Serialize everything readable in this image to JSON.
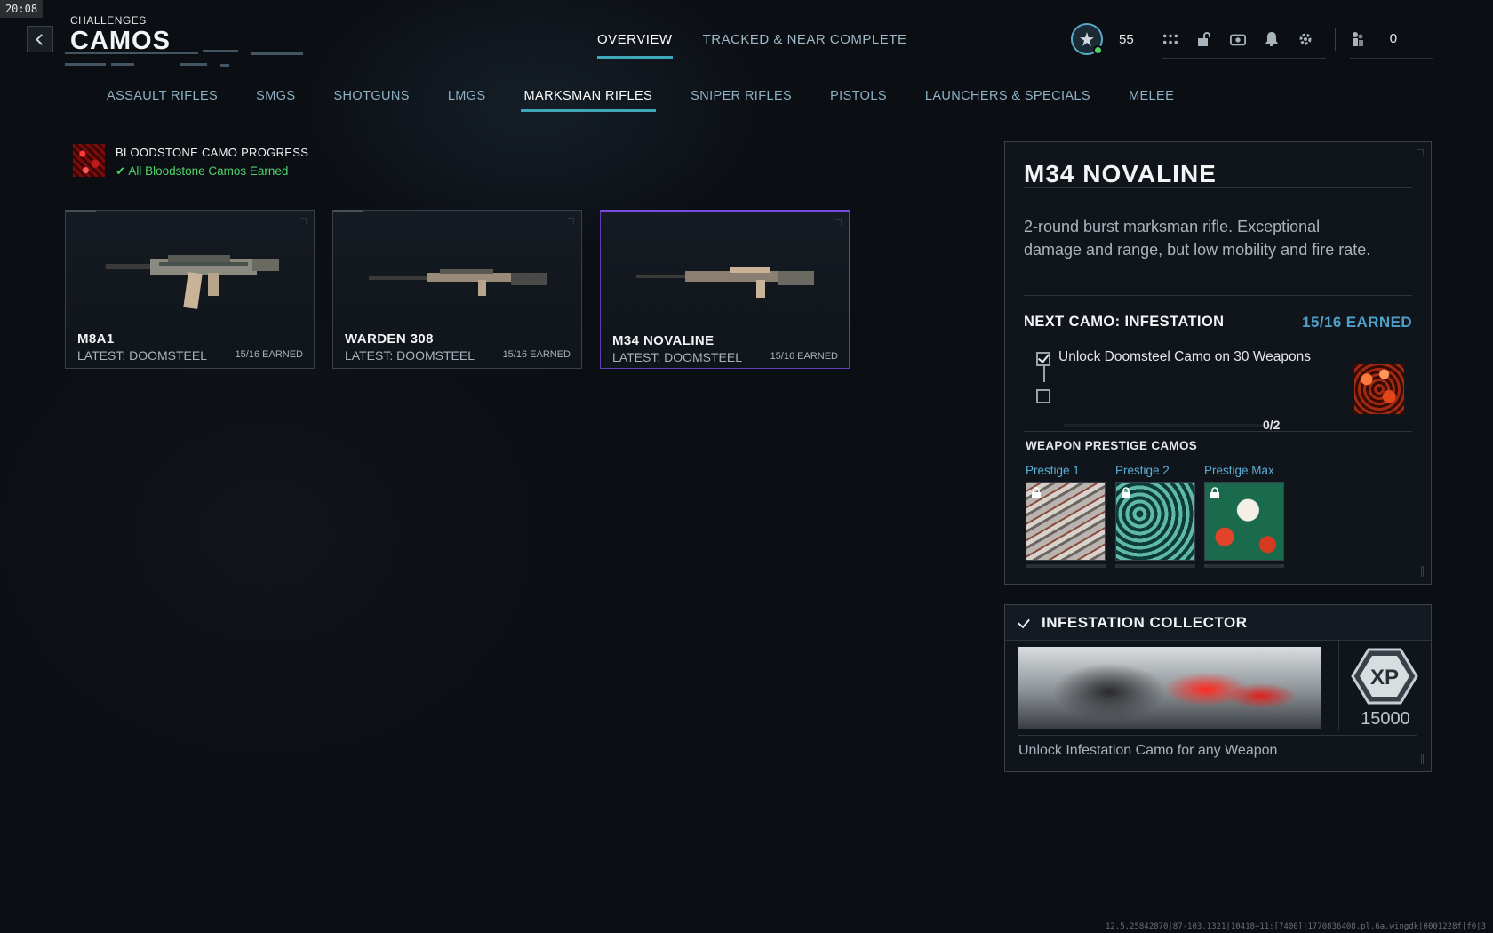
{
  "clock": "20:08",
  "header": {
    "breadcrumb": "CHALLENGES",
    "title": "CAMOS"
  },
  "top_tabs": [
    {
      "label": "OVERVIEW",
      "active": true
    },
    {
      "label": "TRACKED & NEAR COMPLETE",
      "active": false
    }
  ],
  "hud": {
    "level": "55",
    "icons": [
      "grid-icon",
      "unlock-icon",
      "camera-icon",
      "bell-icon",
      "gear-icon",
      "soldiers-icon"
    ],
    "currency": "0"
  },
  "category_tabs": [
    {
      "label": "ASSAULT RIFLES",
      "active": false
    },
    {
      "label": "SMGS",
      "active": false
    },
    {
      "label": "SHOTGUNS",
      "active": false
    },
    {
      "label": "LMGS",
      "active": false
    },
    {
      "label": "MARKSMAN RIFLES",
      "active": true
    },
    {
      "label": "SNIPER RIFLES",
      "active": false
    },
    {
      "label": "PISTOLS",
      "active": false
    },
    {
      "label": "LAUNCHERS & SPECIALS",
      "active": false
    },
    {
      "label": "MELEE",
      "active": false
    }
  ],
  "progress": {
    "title": "BLOODSTONE CAMO PROGRESS",
    "status": "All Bloodstone Camos Earned"
  },
  "weapons": [
    {
      "name": "M8A1",
      "latest": "LATEST: DOOMSTEEL",
      "earned": "15/16 EARNED",
      "selected": false
    },
    {
      "name": "WARDEN 308",
      "latest": "LATEST: DOOMSTEEL",
      "earned": "15/16 EARNED",
      "selected": false
    },
    {
      "name": "M34 NOVALINE",
      "latest": "LATEST: DOOMSTEEL",
      "earned": "15/16 EARNED",
      "selected": true
    }
  ],
  "detail": {
    "title": "M34 NOVALINE",
    "description": "2-round burst marksman rifle. Exceptional damage and range, but low mobility and fire rate.",
    "next_camo": "NEXT CAMO: INFESTATION",
    "earned": "15/16 EARNED",
    "challenge": "Unlock Doomsteel Camo on 30 Weapons",
    "challenge_progress": "0/2",
    "prestige_heading": "WEAPON PRESTIGE CAMOS",
    "prestige": [
      {
        "label": "Prestige 1"
      },
      {
        "label": "Prestige 2"
      },
      {
        "label": "Prestige Max"
      }
    ]
  },
  "collector": {
    "title": "INFESTATION COLLECTOR",
    "xp_label": "XP",
    "xp": "15000",
    "description": "Unlock Infestation Camo for any Weapon"
  },
  "build_info": "12.5.25842870|87-103.1321|10418+11:[7400]|1770836408.pl.6a.wingdk|0001228f|f0|3"
}
